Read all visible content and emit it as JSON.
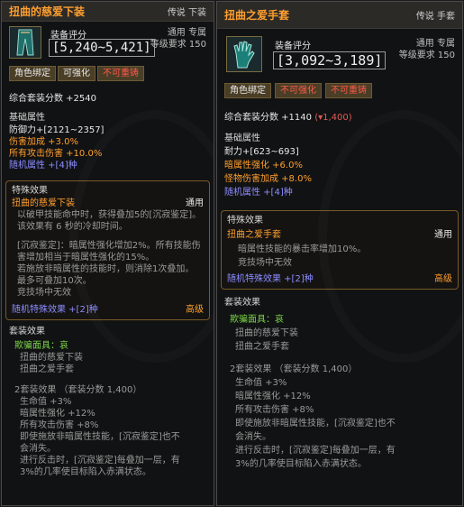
{
  "left": {
    "title": "扭曲的慈爱下装",
    "slot": "传说 下装",
    "rating_label": "装备评分",
    "rating_value": "[5,240~5,421]",
    "usage": "通用 专属",
    "level_req": "等级要求 150",
    "tags": [
      "角色绑定",
      "可强化",
      "不可重铸"
    ],
    "set_score": "综合套装分数 +2540",
    "base_title": "基础属性",
    "base_stats": [
      "防御力+[2121~2357]",
      "伤害加成 +3.0%",
      "所有攻击伤害 +10.0%",
      "随机属性 +[4]种"
    ],
    "special_title": "特殊效果",
    "special_name": "扭曲的慈爱下装",
    "special_scope": "通用",
    "special_desc": [
      "以破甲技能命中时，获得叠加5的[沉寂鉴定]。",
      "该效果有 6 秒的冷却时间。"
    ],
    "special_desc2": [
      "[沉寂鉴定]：暗属性强化增加2%。所有技能伤",
      "害增加相当于暗属性强化的15%。",
      "若施放非暗属性的技能时，则消除1次叠加。",
      "最多可叠加10次。",
      "竞技场中无效"
    ],
    "random_special": "随机特殊效果 +[2]种",
    "random_special_tier": "高级",
    "set_title": "套装效果",
    "set_name": "欺骗面具：哀",
    "set_members": [
      "扭曲的慈爱下装",
      "扭曲之爱手套"
    ],
    "set2_title": "2套装效果 （套装分数 1,400）",
    "set2_lines": [
      "生命值 +3%",
      "暗属性强化 +12%",
      "所有攻击伤害 +8%",
      "即使施放非暗属性技能，[沉寂鉴定]也不",
      "会消失。",
      "进行反击时，[沉寂鉴定]每叠加一层，有",
      "3%的几率使目标陷入赤满状态。"
    ]
  },
  "right": {
    "title": "扭曲之爱手套",
    "slot": "传说 手套",
    "rating_label": "装备评分",
    "rating_value": "[3,092~3,189]",
    "usage": "通用 专属",
    "level_req": "等级要求 150",
    "tags": [
      "角色绑定",
      "不可强化",
      "不可重铸"
    ],
    "set_score": "综合套装分数 +1140",
    "set_score_delta": "(▾1,400)",
    "base_title": "基础属性",
    "base_stats": [
      "耐力+[623~693]",
      "暗属性强化 +6.0%",
      "怪物伤害加成 +8.0%",
      "随机属性 +[4]种"
    ],
    "special_title": "特殊效果",
    "special_name": "扭曲之爱手套",
    "special_scope": "通用",
    "special_desc": [
      "暗属性技能的暴击率增加10%。",
      "竞技场中无效"
    ],
    "random_special": "随机特殊效果 +[2]种",
    "random_special_tier": "高级",
    "set_title": "套装效果",
    "set_name": "欺骗面具：哀",
    "set_members": [
      "扭曲的慈爱下装",
      "扭曲之爱手套"
    ],
    "set2_title": "2套装效果 （套装分数 1,400）",
    "set2_lines": [
      "生命值 +3%",
      "暗属性强化 +12%",
      "所有攻击伤害 +8%",
      "即使施放非暗属性技能，[沉寂鉴定]也不",
      "会消失。",
      "进行反击时，[沉寂鉴定]每叠加一层，有",
      "3%的几率使目标陷入赤满状态。"
    ]
  }
}
